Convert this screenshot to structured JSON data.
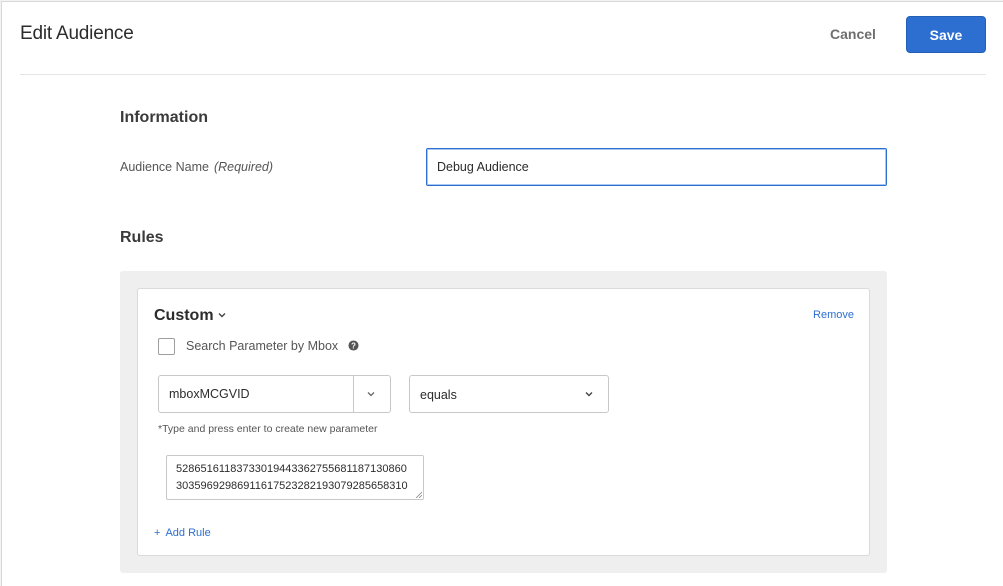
{
  "header": {
    "title": "Edit Audience",
    "cancel_label": "Cancel",
    "save_label": "Save",
    "accent_color": "#2c6fd1"
  },
  "information": {
    "heading": "Information",
    "name_label": "Audience Name",
    "name_required": "(Required)",
    "name_value": "Debug Audience"
  },
  "rules": {
    "heading": "Rules",
    "rule": {
      "type_label": "Custom",
      "type_icon": "chevron-down-icon",
      "remove_label": "Remove",
      "search_by_mbox_label": "Search Parameter by Mbox",
      "search_by_mbox_checked": false,
      "help_icon": "question-circle-icon",
      "parameter_value": "mboxMCGVID",
      "operator_value": "equals",
      "hint": "*Type and press enter to create new parameter",
      "value_line_1": "52865161183733019443362755681187130860",
      "value_line_2": "30359692986911617523282193079285658310"
    },
    "add_rule_label": "Add Rule",
    "add_rule_icon": "plus-icon"
  }
}
